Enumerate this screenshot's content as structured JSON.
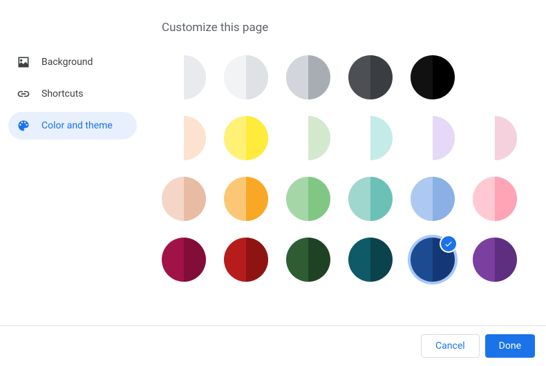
{
  "title": "Customize this page",
  "sidebar": {
    "items": [
      {
        "label": "Background",
        "icon": "image-icon",
        "active": false
      },
      {
        "label": "Shortcuts",
        "icon": "link-icon",
        "active": false
      },
      {
        "label": "Color and theme",
        "icon": "palette-icon",
        "active": true
      }
    ]
  },
  "swatches": [
    {
      "left": "#ffffff",
      "right": "#e8eaed",
      "selected": false
    },
    {
      "left": "#f1f3f4",
      "right": "#dee1e6",
      "selected": false
    },
    {
      "left": "#d2d5db",
      "right": "#a8adb4",
      "selected": false
    },
    {
      "left": "#4c5055",
      "right": "#3a3e42",
      "selected": false
    },
    {
      "left": "#111111",
      "right": "#000000",
      "selected": false
    },
    {
      "left": "#ffffff",
      "right": "#ffffff",
      "selected": false
    },
    {
      "left": "#ffffff",
      "right": "#fde2cf",
      "selected": false
    },
    {
      "left": "#fff176",
      "right": "#ffeb3b",
      "selected": false
    },
    {
      "left": "#ffffff",
      "right": "#d4e8ce",
      "selected": false
    },
    {
      "left": "#ffffff",
      "right": "#c5ebe8",
      "selected": false
    },
    {
      "left": "#ffffff",
      "right": "#e6d9f7",
      "selected": false
    },
    {
      "left": "#ffffff",
      "right": "#f5d0dd",
      "selected": false
    },
    {
      "left": "#f5d6c6",
      "right": "#e8bca3",
      "selected": false
    },
    {
      "left": "#fcc774",
      "right": "#f9a825",
      "selected": false
    },
    {
      "left": "#a5d6a7",
      "right": "#81c784",
      "selected": false
    },
    {
      "left": "#9fd6cd",
      "right": "#6bc1b6",
      "selected": false
    },
    {
      "left": "#aec9ef",
      "right": "#8ab0e6",
      "selected": false
    },
    {
      "left": "#ffc9d4",
      "right": "#ffa3b6",
      "selected": false
    },
    {
      "left": "#a11247",
      "right": "#820e38",
      "selected": false
    },
    {
      "left": "#b71c1c",
      "right": "#8e1414",
      "selected": false
    },
    {
      "left": "#2e5d34",
      "right": "#1f4225",
      "selected": false
    },
    {
      "left": "#0e5a66",
      "right": "#0a434c",
      "selected": false
    },
    {
      "left": "#1c4b91",
      "right": "#143875",
      "selected": true
    },
    {
      "left": "#7b3fa0",
      "right": "#5e2e80",
      "selected": false
    }
  ],
  "footer": {
    "cancel_label": "Cancel",
    "done_label": "Done"
  }
}
